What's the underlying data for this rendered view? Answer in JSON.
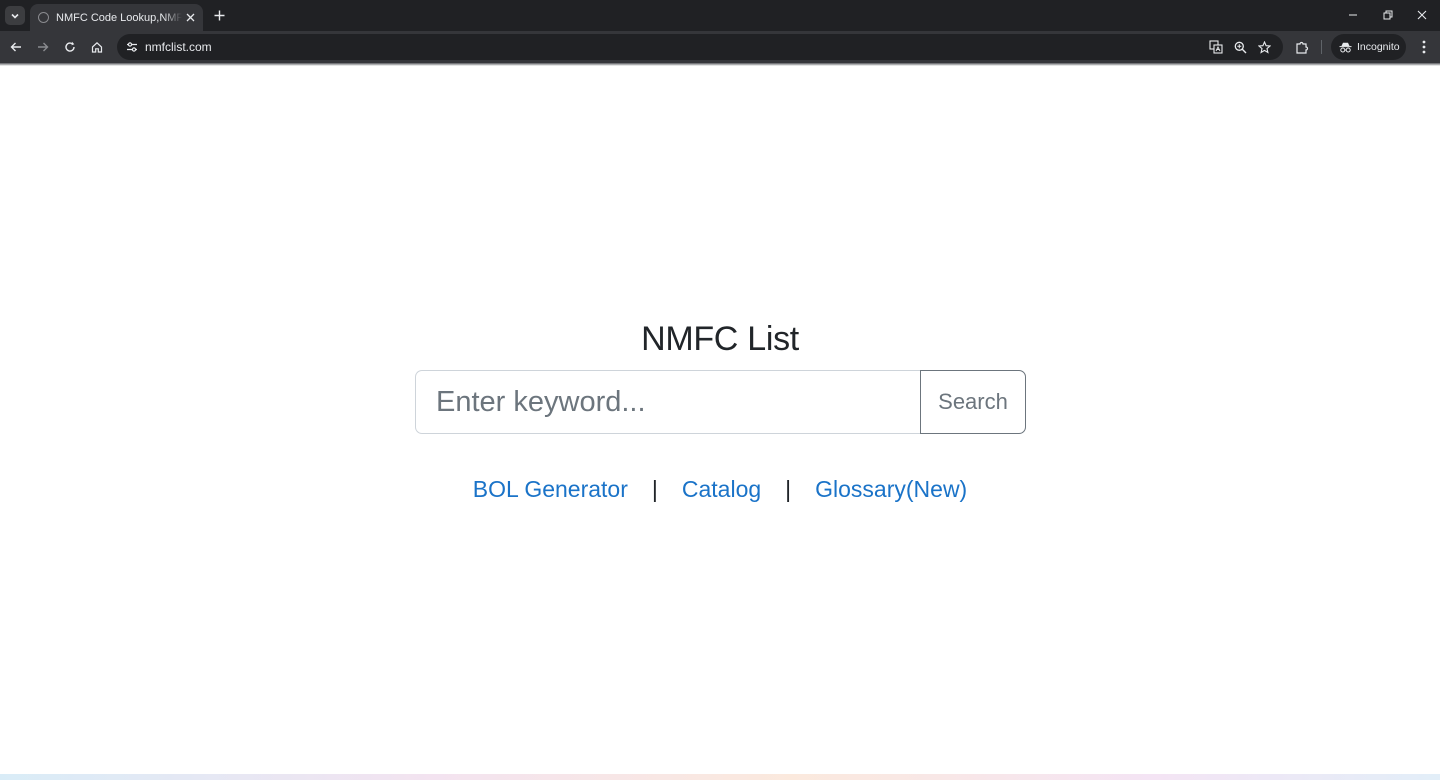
{
  "browser": {
    "tab": {
      "title": "NMFC Code Lookup,NMFC N"
    },
    "address_bar": {
      "url": "nmfclist.com"
    },
    "incognito_label": "Incognito"
  },
  "page": {
    "title": "NMFC List",
    "search": {
      "placeholder": "Enter keyword...",
      "value": "",
      "button_label": "Search"
    },
    "links": [
      {
        "label": "BOL Generator"
      },
      {
        "label": "Catalog"
      },
      {
        "label": "Glossary(New)"
      }
    ],
    "link_divider": "|"
  },
  "colors": {
    "link": "#1a73c8",
    "title_text": "#212529",
    "chrome_dark": "#202124",
    "chrome_toolbar": "#35363a"
  }
}
